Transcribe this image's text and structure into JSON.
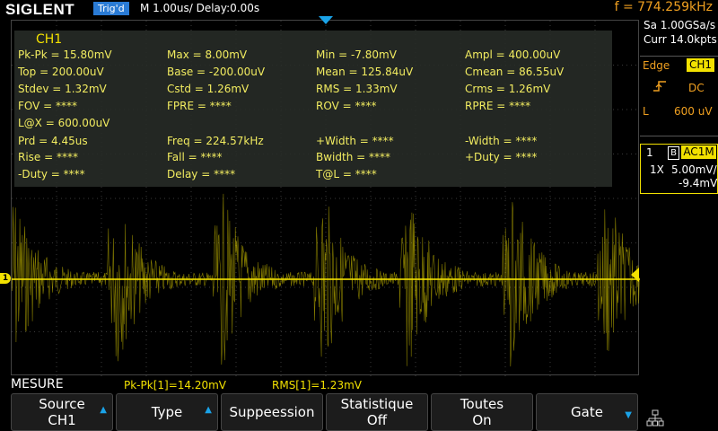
{
  "header": {
    "brand": "SIGLENT",
    "trig_status": "Trig'd",
    "timebase": "M 1.00us/  Delay:0.00s",
    "frequency": "f = 774.259kHz"
  },
  "measure_panel": {
    "channel": "CH1",
    "rows": [
      [
        "Pk-Pk = 15.80mV",
        "Max = 8.00mV",
        "Min = -7.80mV",
        "Ampl = 400.00uV"
      ],
      [
        "Top = 200.00uV",
        "Base = -200.00uV",
        "Mean = 125.84uV",
        "Cmean = 86.55uV"
      ],
      [
        "Stdev = 1.32mV",
        "Cstd = 1.26mV",
        "RMS = 1.33mV",
        "Crms = 1.26mV"
      ],
      [
        "FOV = ****",
        "FPRE = ****",
        "ROV = ****",
        "RPRE = ****"
      ],
      [
        "L@X = 600.00uV",
        "",
        "",
        ""
      ],
      [
        "Prd = 4.45us",
        "Freq = 224.57kHz",
        "+Width = ****",
        "-Width = ****"
      ],
      [
        "Rise = ****",
        "Fall = ****",
        "Bwidth = ****",
        "+Duty = ****"
      ],
      [
        "-Duty = ****",
        "Delay = ****",
        "T@L = ****",
        ""
      ]
    ]
  },
  "right_panel": {
    "sample_rate": "Sa 1.00GSa/s",
    "memory": "Curr 14.0kpts",
    "trigger": {
      "type": "Edge",
      "source": "CH1",
      "slope_icon": "rising-edge-icon",
      "coupling": "DC",
      "level_label": "L",
      "level": "600 uV"
    },
    "channel": {
      "number": "1",
      "bw_badge": "B",
      "coupling": "AC1M",
      "probe": "1X",
      "scale": "5.00mV/",
      "offset": "-9.4mV"
    }
  },
  "screen": {
    "channel_marker": "1",
    "trace_color": "#f2e100",
    "grid_color": "#3a3a3a"
  },
  "status": {
    "menu": "MESURE",
    "stat1": "Pk-Pk[1]=14.20mV",
    "stat2": "RMS[1]=1.23mV"
  },
  "softkeys": [
    {
      "line1": "Source",
      "line2": "CH1",
      "arrow": "up"
    },
    {
      "line1": "Type",
      "line2": "",
      "arrow": "up"
    },
    {
      "line1": "Suppeession",
      "line2": "",
      "arrow": ""
    },
    {
      "line1": "Statistique",
      "line2": "Off",
      "arrow": ""
    },
    {
      "line1": "Toutes",
      "line2": "On",
      "arrow": ""
    },
    {
      "line1": "Gate",
      "line2": "",
      "arrow": "down"
    }
  ],
  "network_icon": "network-icon",
  "colors": {
    "accent_orange": "#f0a020",
    "channel_yellow": "#f2e100",
    "trigger_blue": "#2a7bd5"
  }
}
